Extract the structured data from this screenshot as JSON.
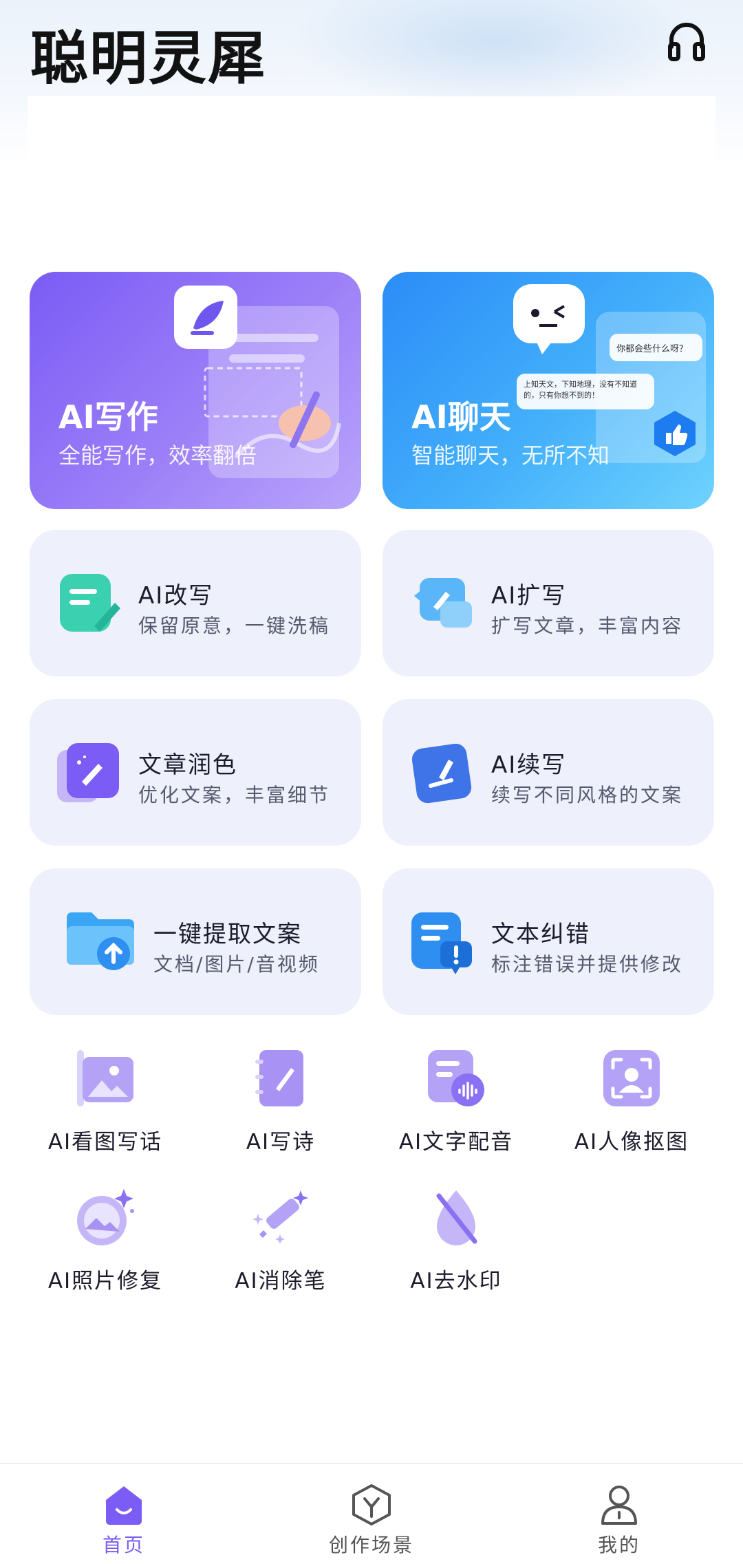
{
  "header": {
    "title": "聪明灵犀"
  },
  "big_cards": [
    {
      "title": "AI写作",
      "subtitle": "全能写作，效率翻倍"
    },
    {
      "title": "AI聊天",
      "subtitle": "智能聊天，无所不知"
    }
  ],
  "chat_bubbles": {
    "question": "你都会些什么呀？",
    "answer": "上知天文，下知地理，没有不知道的，只有你想不到的！"
  },
  "features": [
    {
      "title": "AI改写",
      "subtitle": "保留原意，一键洗稿"
    },
    {
      "title": "AI扩写",
      "subtitle": "扩写文章，丰富内容"
    },
    {
      "title": "文章润色",
      "subtitle": "优化文案，丰富细节"
    },
    {
      "title": "AI续写",
      "subtitle": "续写不同风格的文案"
    },
    {
      "title": "一键提取文案",
      "subtitle": "文档/图片/音视频"
    },
    {
      "title": "文本纠错",
      "subtitle": "标注错误并提供修改"
    }
  ],
  "tools": [
    {
      "label": "AI看图写话",
      "icon": "image-icon"
    },
    {
      "label": "AI写诗",
      "icon": "notebook-brush-icon"
    },
    {
      "label": "AI文字配音",
      "icon": "voice-doc-icon"
    },
    {
      "label": "AI人像抠图",
      "icon": "face-scan-icon"
    },
    {
      "label": "AI照片修复",
      "icon": "photo-sparkle-icon"
    },
    {
      "label": "AI消除笔",
      "icon": "magic-wand-icon"
    },
    {
      "label": "AI去水印",
      "icon": "no-drop-icon"
    }
  ],
  "nav": [
    {
      "label": "首页",
      "active": true
    },
    {
      "label": "创作场景",
      "active": false
    },
    {
      "label": "我的",
      "active": false
    }
  ],
  "colors": {
    "accent": "#7b5cf5",
    "chat_blue": "#2b8cf7",
    "card_bg": "#eef0fb"
  }
}
